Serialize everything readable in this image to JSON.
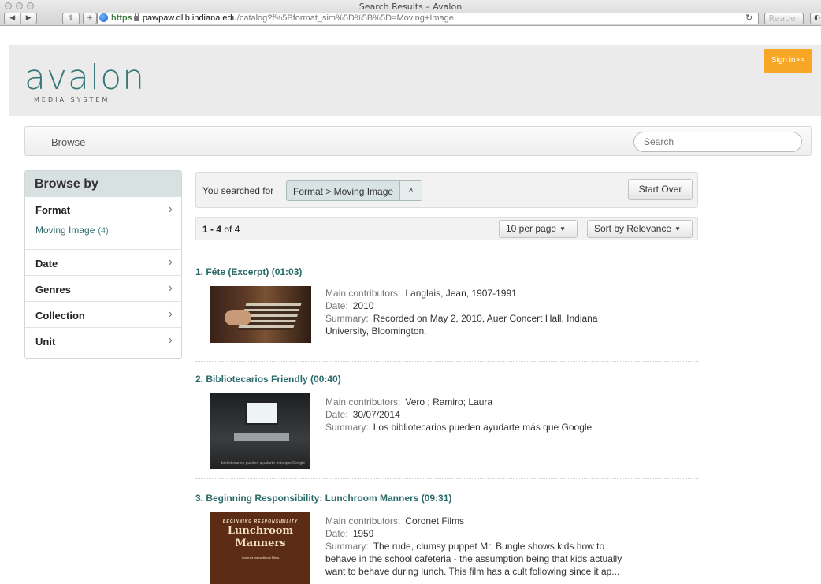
{
  "browser": {
    "window_title": "Search Results – Avalon",
    "url_scheme": "https",
    "url_domain": "pawpaw.dlib.indiana.edu",
    "url_path": "/catalog?f%5Bformat_sim%5D%5B%5D=Moving+Image",
    "reload_icon": "reload-icon",
    "reader_label": "Reader"
  },
  "header": {
    "logo_word": "avalon",
    "logo_sub": "MEDIA SYSTEM",
    "signin_label": "Sign in>>",
    "signin_color": "#f8a625"
  },
  "nav": {
    "browse_label": "Browse",
    "search_placeholder": "Search"
  },
  "sidebar": {
    "title": "Browse by",
    "format_label": "Format",
    "format_value": "Moving Image",
    "format_count": "(4)",
    "items": [
      "Date",
      "Genres",
      "Collection",
      "Unit"
    ]
  },
  "constraints": {
    "label": "You searched for",
    "filter": "Format > Moving Image",
    "remove": "×",
    "start_over": "Start Over"
  },
  "pagination": {
    "range": "1 - 4",
    "of": "of 4",
    "per_page": "10 per page",
    "sort": "Sort by Relevance"
  },
  "results": [
    {
      "title": "1. Féte (Excerpt) (01:03)",
      "contributors_key": "Main contributors:",
      "contributors": "Langlais, Jean, 1907-1991",
      "date_key": "Date:",
      "date": "2010",
      "summary_key": "Summary:",
      "summary_line1": "Recorded on May 2, 2010, Auer Concert Hall, Indiana",
      "summary_line2": "University, Bloomington."
    },
    {
      "title": "2. Bibliotecarios Friendly (00:40)",
      "contributors_key": "Main contributors:",
      "contributors": "Vero ; Ramiro; Laura",
      "date_key": "Date:",
      "date": "30/07/2014",
      "summary_key": "Summary:",
      "summary_line1": "Los bibliotecarios pueden ayudarte más que Google",
      "thumb_caption": "bibliotecarios pueden ayudarte más que Google"
    },
    {
      "title": "3. Beginning Responsibility: Lunchroom Manners (09:31)",
      "contributors_key": "Main contributors:",
      "contributors": "Coronet Films",
      "date_key": "Date:",
      "date": "1959",
      "summary_key": "Summary:",
      "summary_line1": "The rude, clumsy puppet Mr. Bungle shows kids how to",
      "summary_line2": "behave in the school cafeteria - the assumption being that kids actually",
      "summary_line3": "want to behave during lunch. This film has a cult following since it ap...",
      "thumb_small": "BEGINNING RESPONSIBILITY",
      "thumb_big1": "Lunchroom",
      "thumb_big2": "Manners",
      "thumb_foot": "Coronet Instructional Films"
    }
  ]
}
